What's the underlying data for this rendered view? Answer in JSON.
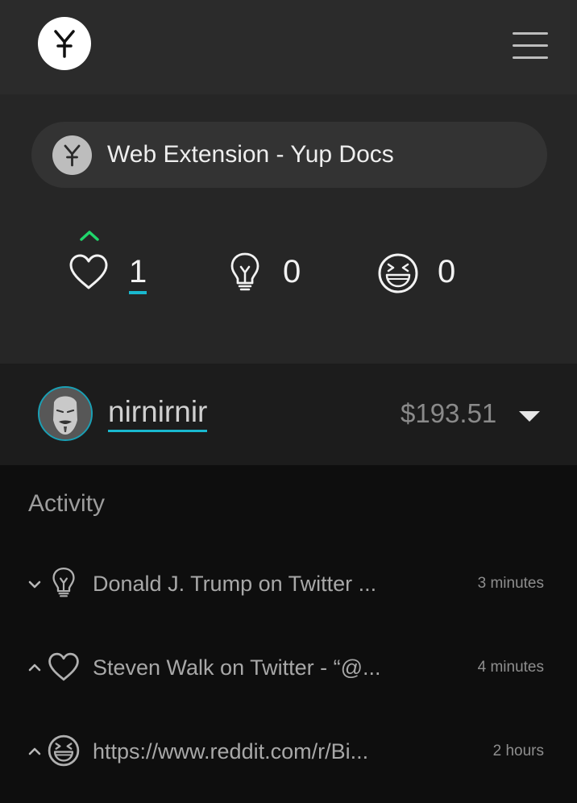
{
  "header": {
    "logo_icon": "yup-logo-icon",
    "menu_icon": "hamburger-menu-icon"
  },
  "page": {
    "title": "Web Extension - Yup Docs",
    "logo_icon": "yup-logo-icon"
  },
  "stats": {
    "like": {
      "icon": "heart-icon",
      "value": "1",
      "voted": true
    },
    "idea": {
      "icon": "lightbulb-icon",
      "value": "0"
    },
    "fun": {
      "icon": "laughing-face-icon",
      "value": "0"
    }
  },
  "user": {
    "name": "nirnirnir",
    "balance": "$193.51",
    "accent_color": "#19b8cf"
  },
  "activity": {
    "title": "Activity",
    "items": [
      {
        "direction": "down",
        "icon": "lightbulb-icon",
        "text": "Donald J. Trump on Twitter ...",
        "time": "3 minutes"
      },
      {
        "direction": "up",
        "icon": "heart-icon",
        "text": "Steven Walk on Twitter - “@...",
        "time": "4 minutes"
      },
      {
        "direction": "up",
        "icon": "laughing-face-icon",
        "text": "https://www.reddit.com/r/Bi...",
        "time": "2 hours"
      }
    ]
  },
  "colors": {
    "up_vote": "#20d66b",
    "accent": "#19b8cf"
  }
}
